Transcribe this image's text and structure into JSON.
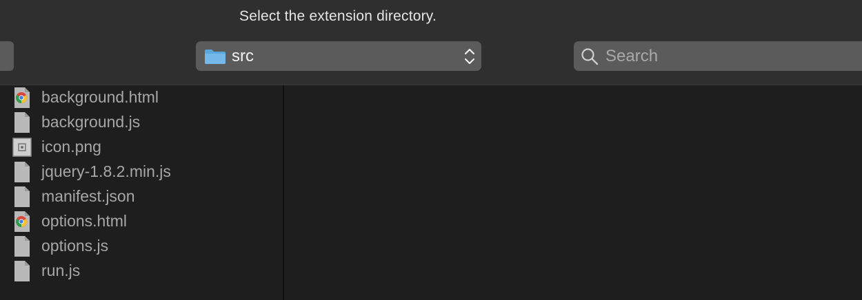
{
  "dialog": {
    "title": "Select the extension directory."
  },
  "location": {
    "folder_name": "src",
    "folder_icon": "folder-icon",
    "folder_color": "#5aa7e0"
  },
  "search": {
    "placeholder": "Search",
    "value": ""
  },
  "files": [
    {
      "name": "background.html",
      "icon": "chrome-html-icon"
    },
    {
      "name": "background.js",
      "icon": "document-icon"
    },
    {
      "name": "icon.png",
      "icon": "image-file-icon"
    },
    {
      "name": "jquery-1.8.2.min.js",
      "icon": "document-icon"
    },
    {
      "name": "manifest.json",
      "icon": "document-icon"
    },
    {
      "name": "options.html",
      "icon": "chrome-html-icon"
    },
    {
      "name": "options.js",
      "icon": "document-icon"
    },
    {
      "name": "run.js",
      "icon": "document-icon"
    }
  ],
  "colors": {
    "toolbar_bg": "#2f2f2f",
    "control_bg": "#5b5b5b",
    "list_bg": "#1e1e1e",
    "file_text": "#a7a7a7"
  }
}
